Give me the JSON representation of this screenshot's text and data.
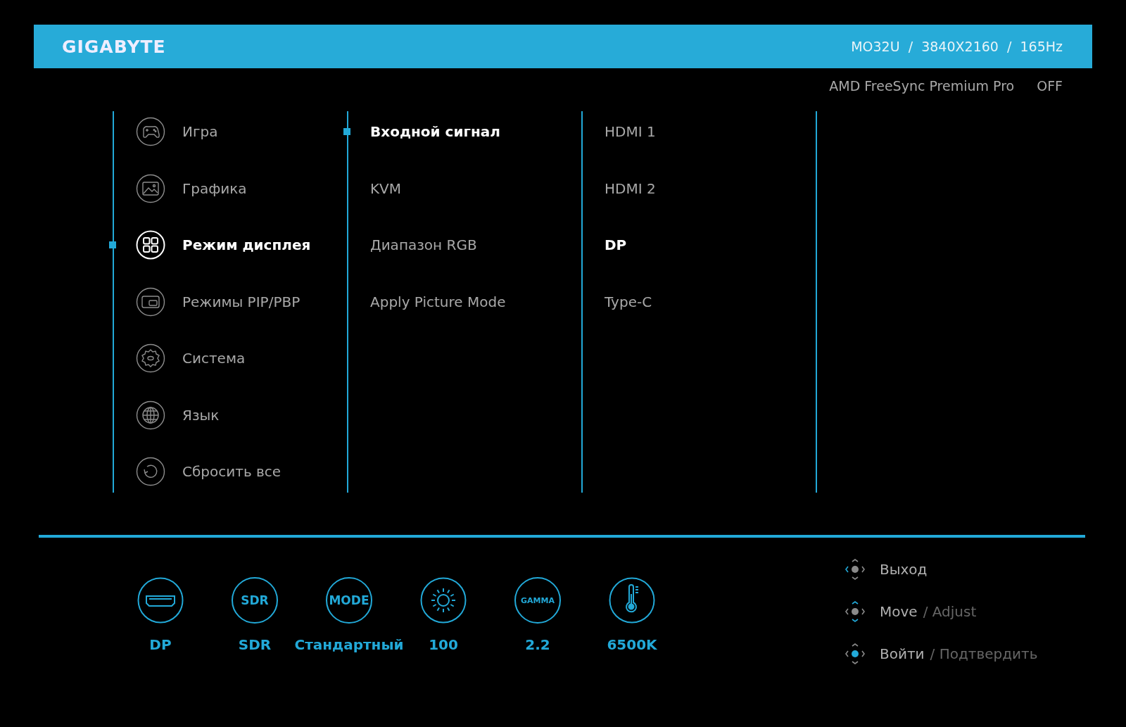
{
  "header": {
    "brand": "GIGABYTE",
    "model_info": "MO32U  /  3840X2160  /  165Hz"
  },
  "freesync": {
    "label": "AMD FreeSync Premium Pro",
    "value": "OFF"
  },
  "main_menu": [
    {
      "label": "Игра",
      "kind": "gamepad",
      "selected": false
    },
    {
      "label": "Графика",
      "kind": "picture",
      "selected": false
    },
    {
      "label": "Режим дисплея",
      "kind": "grid",
      "selected": true
    },
    {
      "label": "Режимы PIP/PBP",
      "kind": "pip",
      "selected": false
    },
    {
      "label": "Система",
      "kind": "gear",
      "selected": false
    },
    {
      "label": "Язык",
      "kind": "globe",
      "selected": false
    },
    {
      "label": "Сбросить все",
      "kind": "reset",
      "selected": false
    }
  ],
  "submenu": [
    {
      "label": "Входной сигнал",
      "selected": true
    },
    {
      "label": "KVM",
      "selected": false
    },
    {
      "label": "Диапазон  RGB",
      "selected": false
    },
    {
      "label": "Apply Picture Mode",
      "selected": false
    }
  ],
  "options": [
    {
      "label": "HDMI 1",
      "selected": false
    },
    {
      "label": "HDMI 2",
      "selected": false
    },
    {
      "label": "DP",
      "selected": true
    },
    {
      "label": "Type-C",
      "selected": false
    }
  ],
  "status": [
    {
      "kind": "port",
      "value": "DP"
    },
    {
      "kind": "text",
      "icon_text": "SDR",
      "value": "SDR"
    },
    {
      "kind": "text",
      "icon_text": "MODE",
      "value": "Стандартный"
    },
    {
      "kind": "sun",
      "value": "100"
    },
    {
      "kind": "text",
      "icon_text": "GAMMA",
      "value": "2.2"
    },
    {
      "kind": "thermometer",
      "value": "6500K"
    }
  ],
  "hints": [
    {
      "kind": "left",
      "label": "Выход"
    },
    {
      "kind": "updown",
      "label": "Move",
      "secondary": "/ Adjust"
    },
    {
      "kind": "press",
      "label": "Войти",
      "secondary": "/ Подтвердить"
    }
  ]
}
